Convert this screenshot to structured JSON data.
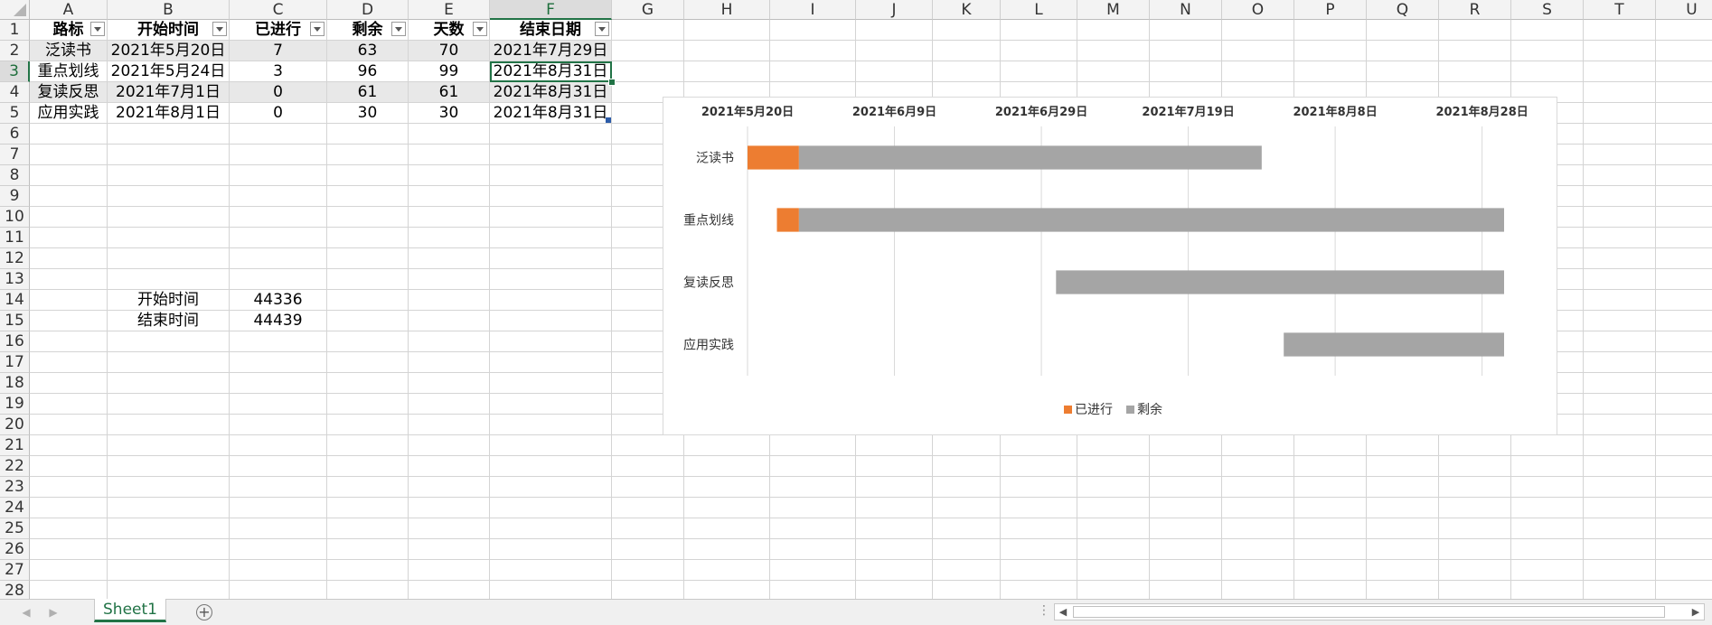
{
  "columns": [
    "A",
    "B",
    "C",
    "D",
    "E",
    "F",
    "G",
    "H",
    "I",
    "J",
    "K",
    "L",
    "M",
    "N",
    "O",
    "P",
    "Q",
    "R",
    "S",
    "T",
    "U"
  ],
  "rows": [
    "1",
    "2",
    "3",
    "4",
    "5",
    "6",
    "7",
    "8",
    "9",
    "10",
    "11",
    "12",
    "13",
    "14",
    "15",
    "16",
    "17",
    "18",
    "19",
    "20",
    "21",
    "22",
    "23",
    "24",
    "25",
    "26",
    "27",
    "28"
  ],
  "selected_col": "F",
  "selected_row": "3",
  "table": {
    "headers": [
      "路标",
      "开始时间",
      "已进行",
      "剩余",
      "天数",
      "结束日期"
    ],
    "rows": [
      [
        "泛读书",
        "2021年5月20日",
        "7",
        "63",
        "70",
        "2021年7月29日"
      ],
      [
        "重点划线",
        "2021年5月24日",
        "3",
        "96",
        "99",
        "2021年8月31日"
      ],
      [
        "复读反思",
        "2021年7月1日",
        "0",
        "61",
        "61",
        "2021年8月31日"
      ],
      [
        "应用实践",
        "2021年8月1日",
        "0",
        "30",
        "30",
        "2021年8月31日"
      ]
    ]
  },
  "extra": {
    "start_label": "开始时间",
    "start_value": "44336",
    "end_label": "结束时间",
    "end_value": "44439"
  },
  "chart_data": {
    "type": "bar",
    "orientation": "horizontal-stacked",
    "categories": [
      "泛读书",
      "重点划线",
      "复读反思",
      "应用实践"
    ],
    "x_tick_labels": [
      "2021年5月20日",
      "2021年6月9日",
      "2021年6月29日",
      "2021年7月19日",
      "2021年8月8日",
      "2021年8月28日"
    ],
    "x_ticks": [
      44336,
      44356,
      44376,
      44396,
      44416,
      44436
    ],
    "xlim": [
      44336,
      44439
    ],
    "offset_start": [
      44336,
      44340,
      44378,
      44409
    ],
    "series": [
      {
        "name": "已进行",
        "values": [
          7,
          3,
          0,
          0
        ],
        "color": "#ED7D31"
      },
      {
        "name": "剩余",
        "values": [
          63,
          96,
          61,
          30
        ],
        "color": "#A5A5A5"
      }
    ],
    "legend_position": "bottom",
    "x_axis_position": "top",
    "grid": true
  },
  "sheet_tab": "Sheet1",
  "icons": {
    "add_sheet": "plus-circle-icon",
    "prev_sheet": "arrow-left-icon",
    "next_sheet": "arrow-right-icon"
  }
}
